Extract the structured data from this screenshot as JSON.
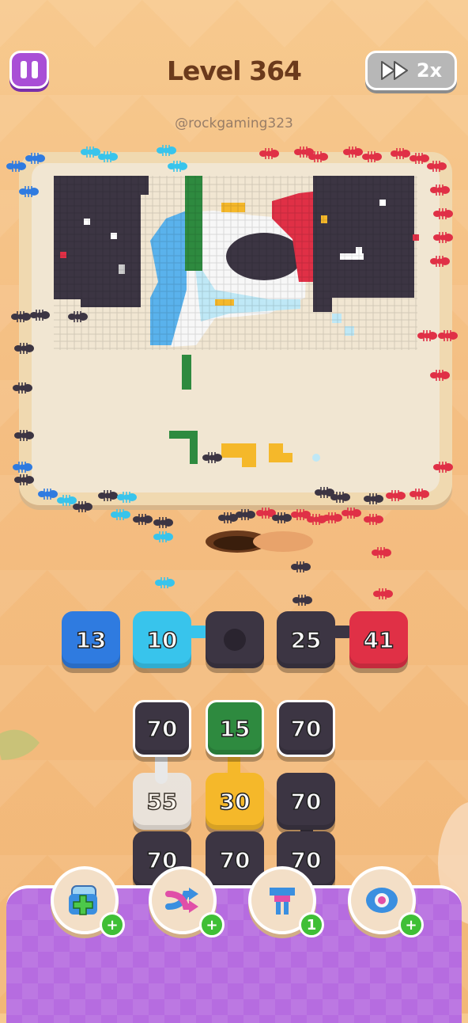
{
  "header": {
    "level_title": "Level 364",
    "speed_label": "2x",
    "watermark": "@rockgaming323"
  },
  "queue_tiles": [
    {
      "value": "13",
      "color": "#2f7be0"
    },
    {
      "value": "10",
      "color": "#38c4ec"
    },
    {
      "value": "",
      "color": "#3c3543"
    },
    {
      "value": "25",
      "color": "#3c3543"
    },
    {
      "value": "41",
      "color": "#e03046"
    }
  ],
  "grid_tiles": [
    {
      "value": "70",
      "color": "#3c3543"
    },
    {
      "value": "15",
      "color": "#2e8a3f"
    },
    {
      "value": "70",
      "color": "#3c3543"
    },
    {
      "value": "55",
      "color": "#e8e8e8"
    },
    {
      "value": "30",
      "color": "#f5b82a"
    },
    {
      "value": "70",
      "color": "#3c3543"
    },
    {
      "value": "70",
      "color": "#3c3543"
    },
    {
      "value": "70",
      "color": "#3c3543"
    },
    {
      "value": "70",
      "color": "#3c3543"
    }
  ],
  "boosters": [
    {
      "icon": "add-slot-icon",
      "badge": "+"
    },
    {
      "icon": "shuffle-icon",
      "badge": "+"
    },
    {
      "icon": "magnet-icon",
      "badge": "1"
    },
    {
      "icon": "blob-icon",
      "badge": "+"
    }
  ],
  "ant_colors": {
    "blue": "#2f7be0",
    "cyan": "#38c4ec",
    "dark": "#3c3543",
    "red": "#e03046",
    "green": "#2e8a3f",
    "yellow": "#f5b82a",
    "white": "#f4f4f4"
  }
}
